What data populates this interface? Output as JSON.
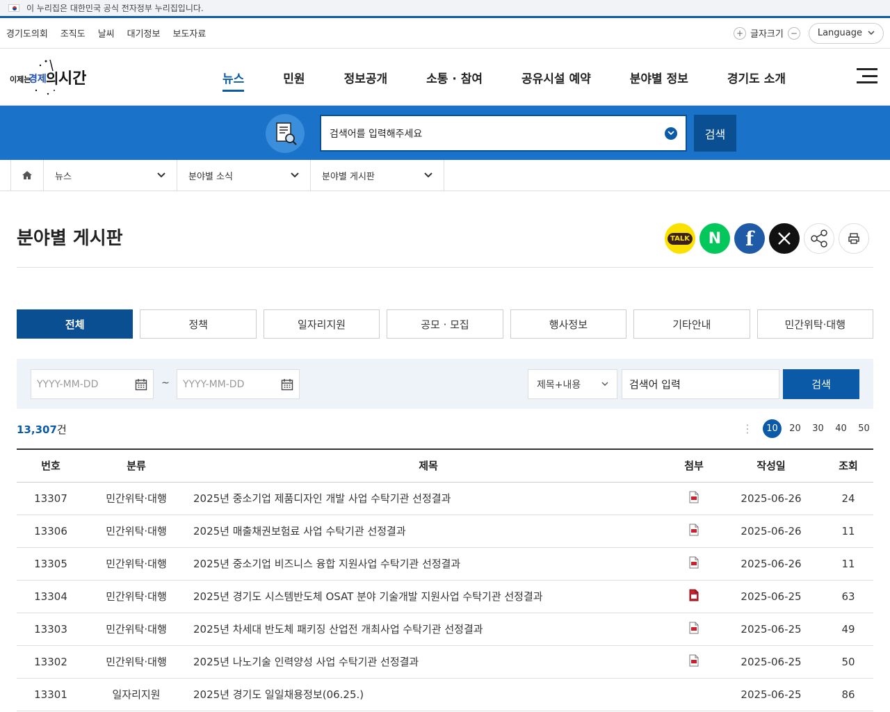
{
  "gov_banner": {
    "text": "이 누리집은 대한민국 공식 전자정부 누리집입니다."
  },
  "util": {
    "links": [
      "경기도의회",
      "조직도",
      "날씨",
      "대기정보",
      "보도자료"
    ],
    "font_size_label": "글자크기",
    "language_label": "Language"
  },
  "gnb": {
    "items": [
      "뉴스",
      "민원",
      "정보공개",
      "소통 · 참여",
      "공유시설 예약",
      "분야별 정보",
      "경기도 소개"
    ],
    "active_index": 0
  },
  "search": {
    "placeholder": "검색어를 입력해주세요",
    "button": "검색"
  },
  "breadcrumb": {
    "items": [
      "뉴스",
      "분야별 소식",
      "분야별 게시판"
    ]
  },
  "page": {
    "title": "분야별 게시판",
    "share": {
      "kakao_label": "TALK",
      "naver_label": "N",
      "facebook_label": "f",
      "x_label": "𝕏"
    }
  },
  "tabs": {
    "items": [
      "전체",
      "정책",
      "일자리지원",
      "공모 · 모집",
      "행사정보",
      "기타안내",
      "민간위탁·대행"
    ],
    "active_index": 0
  },
  "filter": {
    "start_placeholder": "YYYY-MM-DD",
    "tilde": "~",
    "end_placeholder": "YYYY-MM-DD",
    "select_value": "제목+내용",
    "keyword_placeholder": "검색어 입력",
    "button": "검색"
  },
  "list": {
    "count_number": "13,307",
    "count_unit": "건",
    "page_sizes": [
      "10",
      "20",
      "30",
      "40",
      "50"
    ],
    "active_page_size": "10",
    "columns": [
      "번호",
      "분류",
      "제목",
      "첨부",
      "작성일",
      "조회"
    ],
    "rows": [
      {
        "no": "13307",
        "cat": "민간위탁·대행",
        "subject": "2025년 중소기업 제품디자인 개발 사업 수탁기관 선정결과",
        "attach": "pdf-icon",
        "date": "2025-06-26",
        "views": "24"
      },
      {
        "no": "13306",
        "cat": "민간위탁·대행",
        "subject": "2025년 매출채권보험료 사업 수탁기관 선정결과",
        "attach": "pdf-icon",
        "date": "2025-06-26",
        "views": "11"
      },
      {
        "no": "13305",
        "cat": "민간위탁·대행",
        "subject": "2025년 중소기업 비즈니스 융합 지원사업 수탁기관 선정결과",
        "attach": "pdf-icon",
        "date": "2025-06-26",
        "views": "11"
      },
      {
        "no": "13304",
        "cat": "민간위탁·대행",
        "subject": "2025년 경기도 시스템반도체 OSAT 분야 기술개발 지원사업 수탁기관 선정결과",
        "attach": "document-icon",
        "date": "2025-06-25",
        "views": "63"
      },
      {
        "no": "13303",
        "cat": "민간위탁·대행",
        "subject": "2025년 차세대 반도체 패키징 산업전 개최사업 수탁기관 선정결과",
        "attach": "pdf-icon",
        "date": "2025-06-25",
        "views": "49"
      },
      {
        "no": "13302",
        "cat": "민간위탁·대행",
        "subject": "2025년 나노기술 인력양성 사업 수탁기관 선정결과",
        "attach": "pdf-icon",
        "date": "2025-06-25",
        "views": "50"
      },
      {
        "no": "13301",
        "cat": "일자리지원",
        "subject": "2025년 경기도 일일채용정보(06.25.)",
        "attach": "",
        "date": "2025-06-25",
        "views": "86"
      }
    ]
  },
  "colors": {
    "primary": "#0b5aa8",
    "dark_primary": "#0b4f93",
    "band": "#1a73c9"
  }
}
